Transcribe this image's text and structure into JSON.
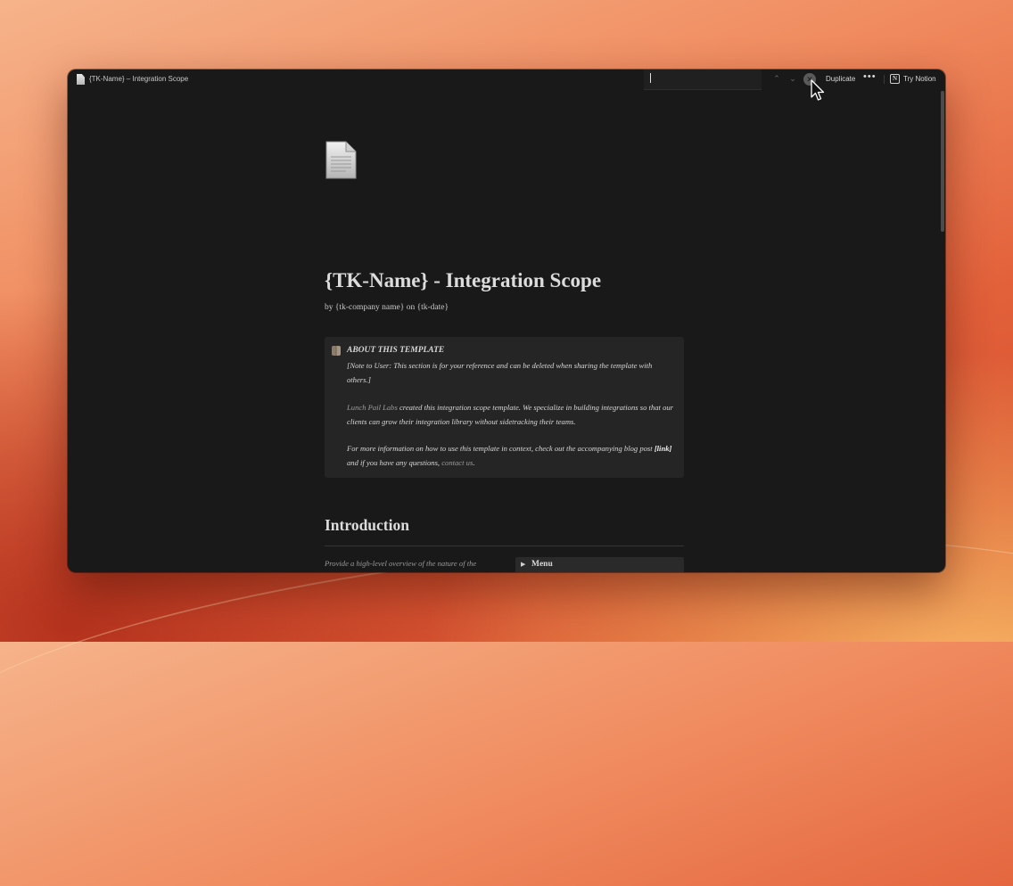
{
  "window": {
    "tab_title": "{TK-Name} – Integration Scope"
  },
  "toolbar": {
    "find_value": "",
    "prev_icon": "⌃",
    "next_icon": "⌄",
    "close_icon": "✕",
    "duplicate_label": "Duplicate",
    "more_icon": "•••",
    "notion_logo": "N",
    "try_notion_label": "Try Notion"
  },
  "page": {
    "title": "{TK-Name} - Integration Scope",
    "byline": "by {tk-company name} on {tk-date}"
  },
  "callout": {
    "heading": "ABOUT THIS TEMPLATE",
    "note": "[Note to User: This section is for your reference and can be deleted when sharing the template with others.]",
    "p2_link": "Lunch Pail Labs",
    "p2_rest": " created this integration scope template. We specialize in building integrations so that our clients can grow their integration library without sidetracking their teams.",
    "p3_start": "For more information on how to use this template in context, check out the accompanying blog post ",
    "p3_bold": "[link]",
    "p3_mid": " and if you have any questions, ",
    "p3_link": "contact us",
    "p3_end": "."
  },
  "introduction": {
    "heading": "Introduction",
    "text": "Provide a high-level overview of the nature of the integration project. Detail any key functionalities or potential applications.",
    "toggle_label": "Menu"
  },
  "icons": {
    "page": "page-icon",
    "callout": "book-icon",
    "toggle": "triangle-right-icon",
    "cursor": "mouse-pointer-icon"
  }
}
